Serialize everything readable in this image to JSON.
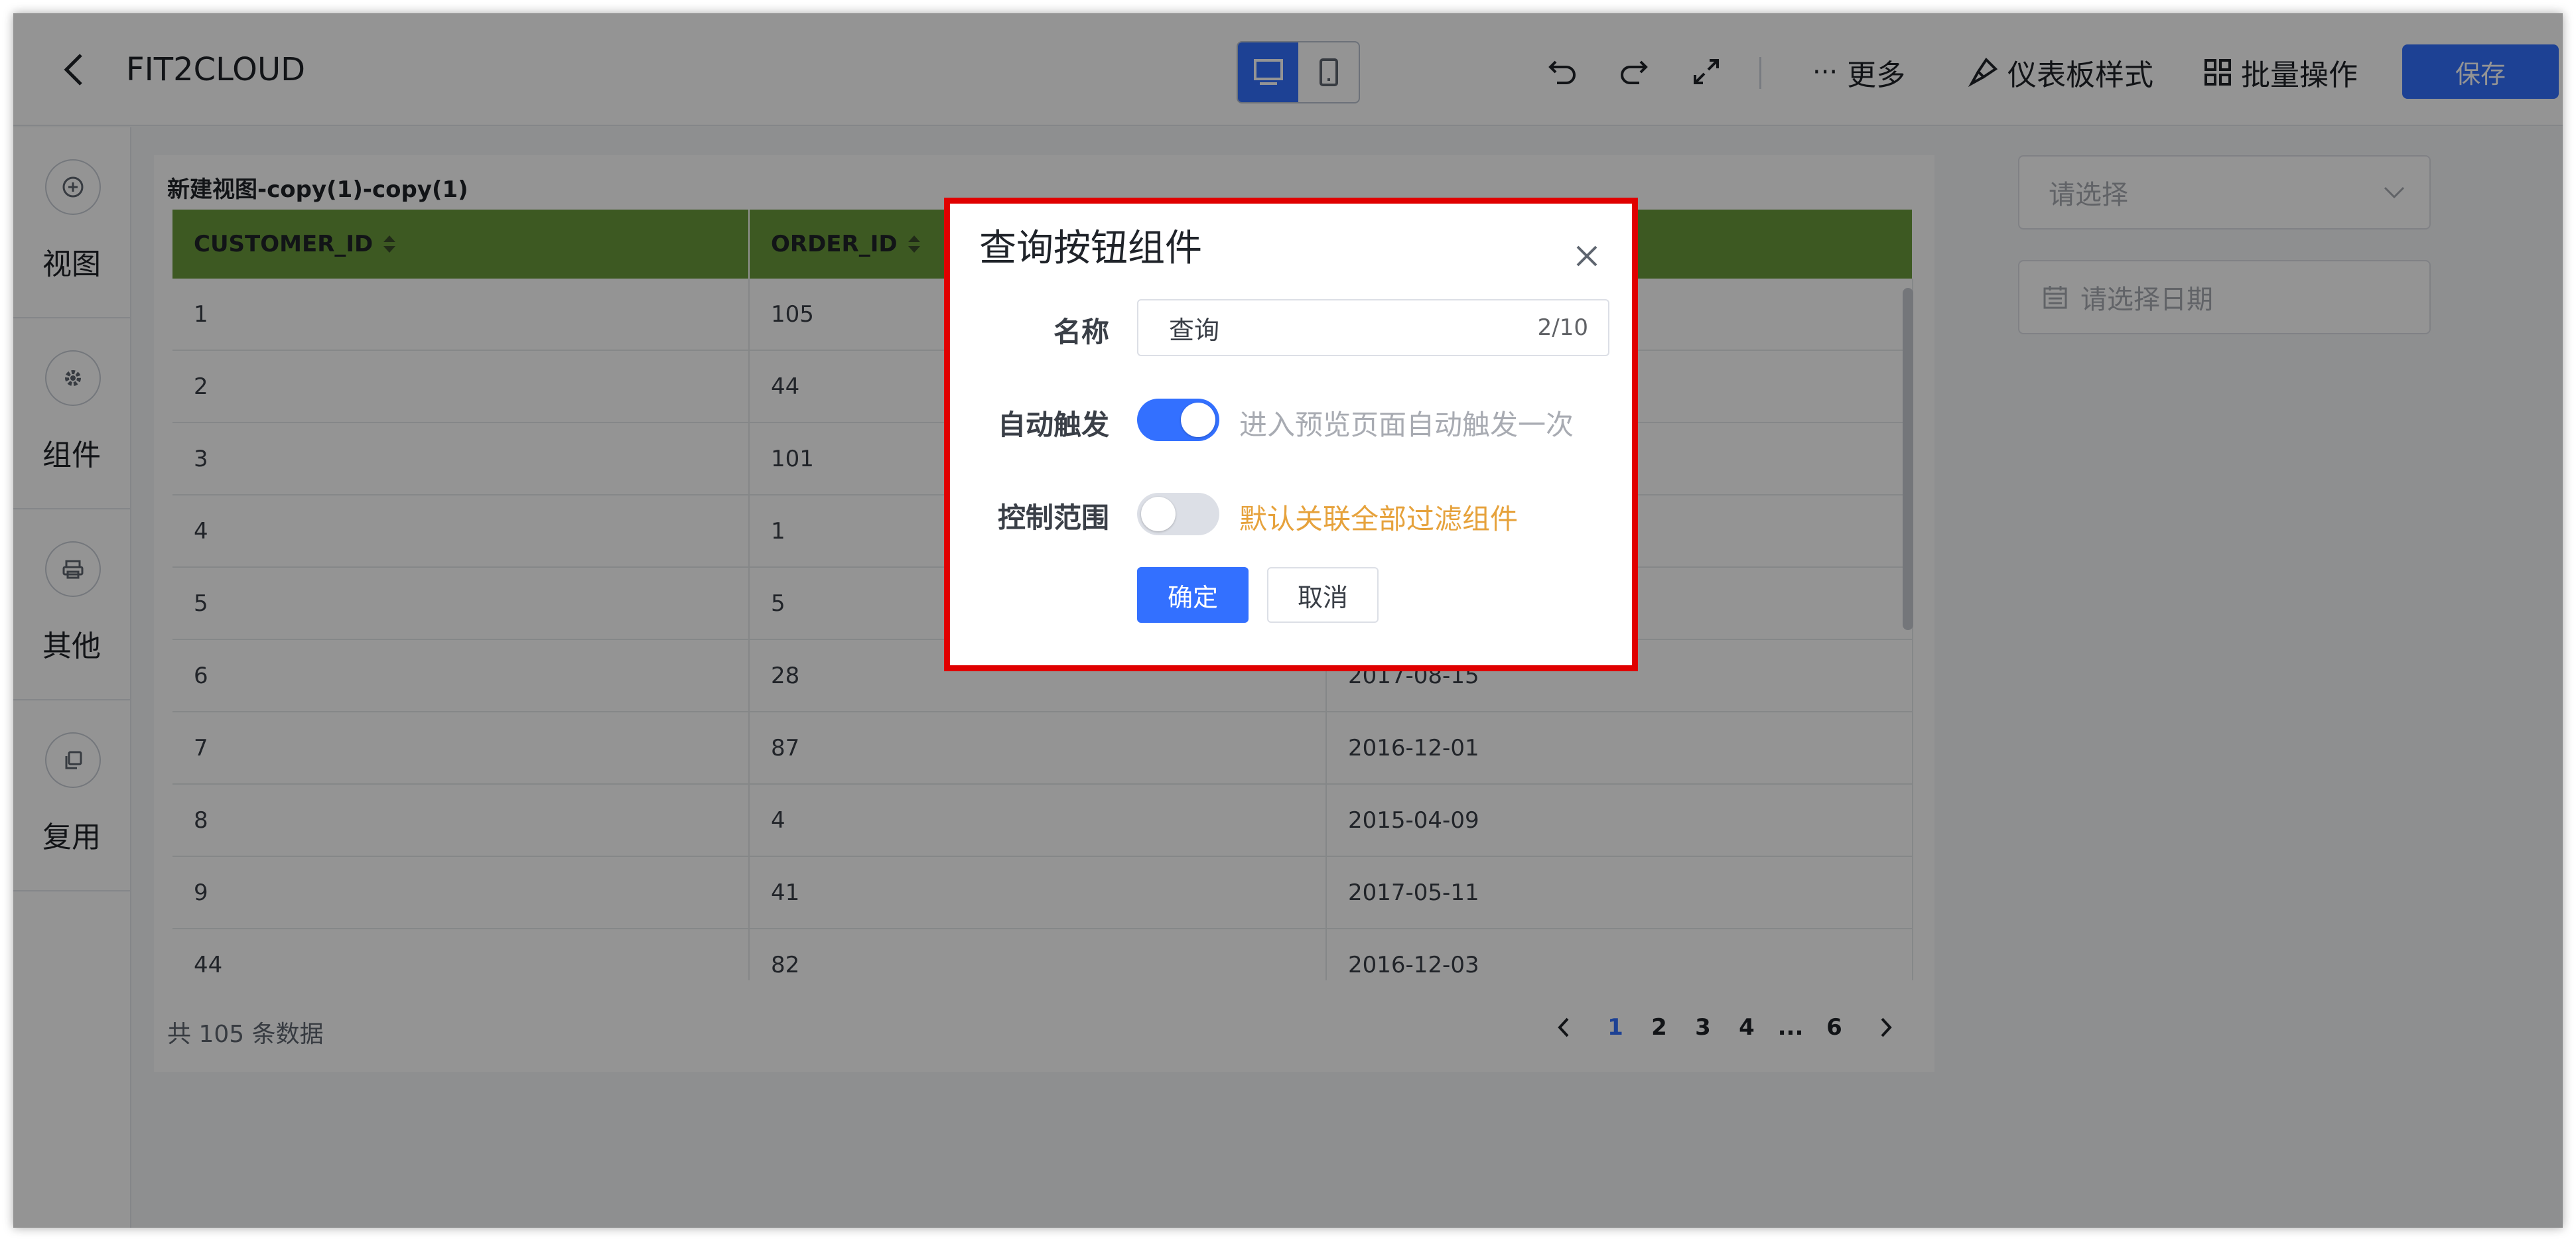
{
  "header": {
    "title": "FIT2CLOUD",
    "more_label": "更多",
    "dashboard_style_label": "仪表板样式",
    "batch_label": "批量操作",
    "save_label": "保存"
  },
  "sidebar": {
    "items": [
      {
        "label": "视图",
        "icon": "plus-circle-icon"
      },
      {
        "label": "组件",
        "icon": "gear-icon"
      },
      {
        "label": "其他",
        "icon": "printer-icon"
      },
      {
        "label": "复用",
        "icon": "copy-icon"
      }
    ]
  },
  "view": {
    "title": "新建视图-copy(1)-copy(1)",
    "columns": [
      "CUSTOMER_ID",
      "ORDER_ID",
      ""
    ],
    "rows": [
      [
        "1",
        "105",
        ""
      ],
      [
        "2",
        "44",
        ""
      ],
      [
        "3",
        "101",
        ""
      ],
      [
        "4",
        "1",
        ""
      ],
      [
        "5",
        "5",
        ""
      ],
      [
        "6",
        "28",
        "2017-08-15"
      ],
      [
        "7",
        "87",
        "2016-12-01"
      ],
      [
        "8",
        "4",
        "2015-04-09"
      ],
      [
        "9",
        "41",
        "2017-05-11"
      ],
      [
        "44",
        "82",
        "2016-12-03"
      ]
    ],
    "total": "共 105 条数据",
    "pages": [
      "1",
      "2",
      "3",
      "4",
      "...",
      "6"
    ],
    "current_page": "1"
  },
  "filters": {
    "select_placeholder": "请选择",
    "date_placeholder": "请选择日期"
  },
  "dialog": {
    "title": "查询按钮组件",
    "name_label": "名称",
    "name_value": "查询",
    "name_count": "2/10",
    "auto_label": "自动触发",
    "auto_on": true,
    "auto_hint": "进入预览页面自动触发一次",
    "scope_label": "控制范围",
    "scope_on": false,
    "scope_hint": "默认关联全部过滤组件",
    "confirm_label": "确定",
    "cancel_label": "取消"
  },
  "colors": {
    "primary": "#3370ff",
    "table_header": "#6a9a3c",
    "highlight_border": "#e00000",
    "scope_hint": "#e6a23c",
    "muted_hint": "#a8abb2"
  }
}
